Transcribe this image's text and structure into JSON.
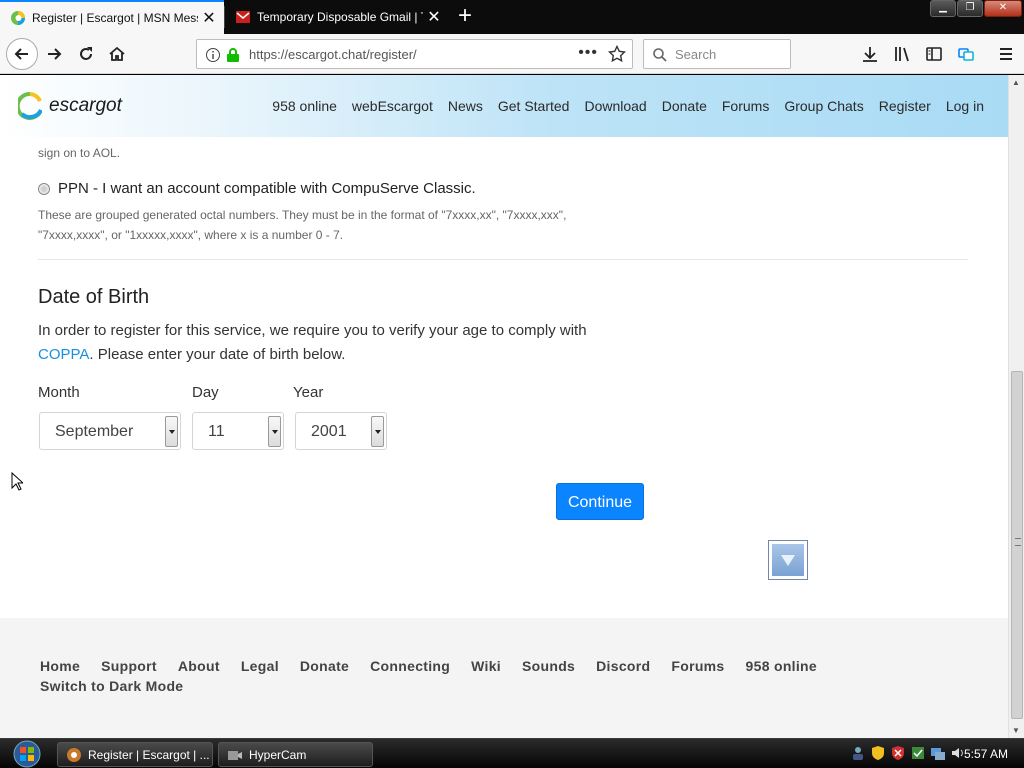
{
  "browser": {
    "tabs": [
      {
        "title": "Register | Escargot | MSN Messen",
        "active": true
      },
      {
        "title": "Temporary Disposable Gmail | Tem",
        "active": false
      }
    ],
    "url": "https://escargot.chat/register/",
    "search_placeholder": "Search",
    "accent_color": "#0a84ff"
  },
  "site": {
    "logo_text": "escargot",
    "nav": [
      "958 online",
      "webEscargot",
      "News",
      "Get Started",
      "Download",
      "Donate",
      "Forums",
      "Group Chats",
      "Register",
      "Log in"
    ]
  },
  "form": {
    "aol_tail": "sign on to AOL.",
    "ppn_label": "PPN - I want an account compatible with CompuServe Classic.",
    "ppn_note": "These are grouped generated octal numbers. They must be in the format of \"7xxxx,xx\", \"7xxxx,xxx\", \"7xxxx,xxxx\", or \"1xxxxx,xxxx\", where x is a number 0 - 7.",
    "dob_title": "Date of Birth",
    "dob_text_before": "In order to register for this service, we require you to verify your age to comply with",
    "dob_link": "COPPA",
    "dob_text_after": ". Please enter your date of birth below.",
    "month_label": "Month",
    "day_label": "Day",
    "year_label": "Year",
    "month_value": "September",
    "day_value": "11",
    "year_value": "2001",
    "continue_label": "Continue"
  },
  "footer": {
    "links": [
      "Home",
      "Support",
      "About",
      "Legal",
      "Donate",
      "Connecting",
      "Wiki",
      "Sounds",
      "Discord",
      "Forums",
      "958 online",
      "Switch to Dark Mode"
    ]
  },
  "taskbar": {
    "items": [
      "Register | Escargot | ...",
      "HyperCam"
    ],
    "clock": "5:57 AM"
  }
}
